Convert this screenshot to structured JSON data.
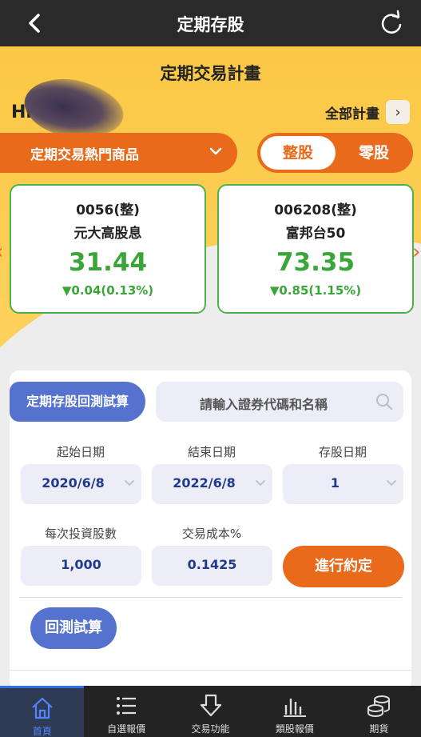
{
  "header": {
    "title": "定期存股"
  },
  "hero": {
    "plan_title": "定期交易計畫",
    "greeting": "Hi",
    "all_plans_label": "全部計畫",
    "all_plans_arrow": "›",
    "hot_dropdown_label": "定期交易熱門商品",
    "segment": {
      "whole": "整股",
      "odd": "零股",
      "selected": "整股"
    }
  },
  "cards": [
    {
      "code": "0056(整)",
      "name": "元大高股息",
      "price": "31.44",
      "change": "▼0.04(0.13%)"
    },
    {
      "code": "006208(整)",
      "name": "富邦台50",
      "price": "73.35",
      "change": "▼0.85(1.15%)"
    }
  ],
  "colors": {
    "accent": "#e96a1b",
    "blue": "#5572cf",
    "down_green": "#3aa63a",
    "hero_yellow": "#fbc845"
  },
  "backtest": {
    "tab_label": "定期存股回測試算",
    "search_placeholder": "請輸入證券代碼和名稱",
    "start_date_label": "起始日期",
    "start_date_value": "2020/6/8",
    "end_date_label": "結束日期",
    "end_date_value": "2022/6/8",
    "deposit_day_label": "存股日期",
    "deposit_day_value": "1",
    "shares_label": "每次投資股數",
    "shares_value": "1,000",
    "cost_label": "交易成本%",
    "cost_value": "0.1425",
    "confirm_label": "進行約定",
    "calc_label": "回測試算"
  },
  "nav": [
    {
      "label": "首頁",
      "icon": "home-icon",
      "active": true
    },
    {
      "label": "自選報價",
      "icon": "list-icon",
      "active": false
    },
    {
      "label": "交易功能",
      "icon": "trade-arrow-icon",
      "active": false
    },
    {
      "label": "類股報價",
      "icon": "bar-chart-icon",
      "active": false
    },
    {
      "label": "期貨",
      "icon": "coins-icon",
      "active": false
    }
  ]
}
